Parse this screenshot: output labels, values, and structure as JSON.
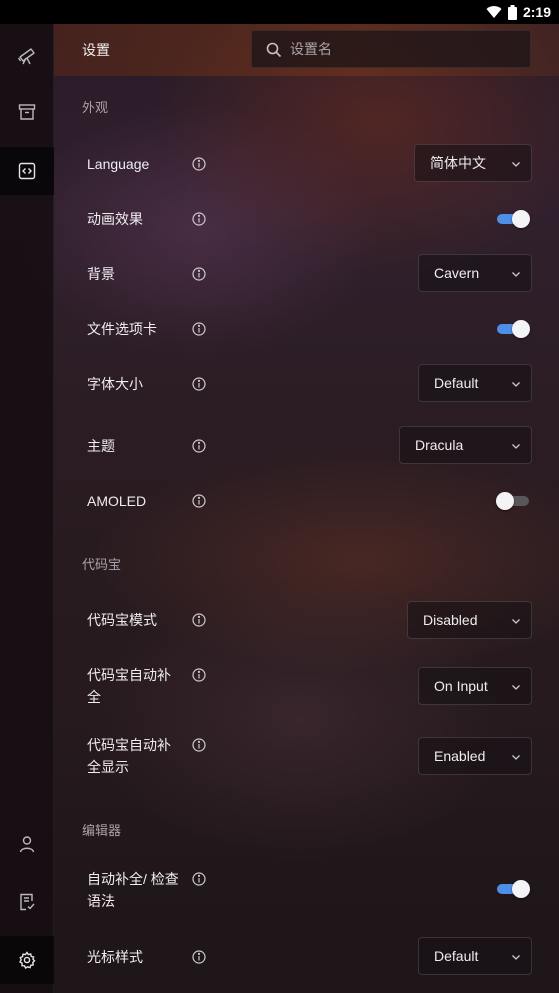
{
  "status_bar": {
    "time": "2:19"
  },
  "header": {
    "title": "设置",
    "search_placeholder": "设置名"
  },
  "sections": {
    "appearance": {
      "title": "外观",
      "language": {
        "label": "Language",
        "value": "简体中文"
      },
      "animation": {
        "label": "动画效果",
        "enabled": true
      },
      "background": {
        "label": "背景",
        "value": "Cavern"
      },
      "file_tabs": {
        "label": "文件选项卡",
        "enabled": true
      },
      "font_size": {
        "label": "字体大小",
        "value": "Default"
      },
      "theme": {
        "label": "主题",
        "value": "Dracula"
      },
      "amoled": {
        "label": "AMOLED",
        "enabled": false
      }
    },
    "codeium": {
      "title": "代码宝",
      "mode": {
        "label": "代码宝模式",
        "value": "Disabled"
      },
      "autocomplete": {
        "label": "代码宝自动补全",
        "value": "On Input"
      },
      "autocomplete_display": {
        "label": "代码宝自动补全显示",
        "value": "Enabled"
      }
    },
    "editor": {
      "title": "编辑器",
      "autocomplete_lint": {
        "label": "自动补全/ 检查语法",
        "enabled": true
      },
      "cursor_style": {
        "label": "光标样式",
        "value": "Default"
      }
    }
  },
  "colors": {
    "accent": "#4f8fe8",
    "active_rail": "#080608"
  },
  "icons": [
    "telescope-icon",
    "archive-icon",
    "code-icon",
    "user-icon",
    "document-check-icon",
    "settings-icon",
    "search-icon",
    "info-icon",
    "chevron-down-icon"
  ]
}
